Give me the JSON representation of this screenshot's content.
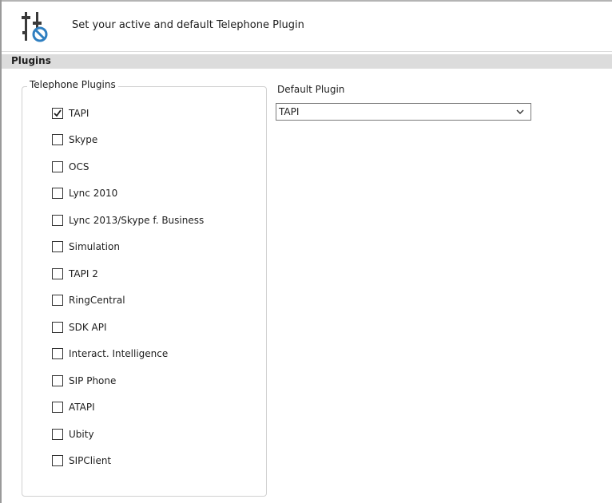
{
  "header": {
    "title": "Set your active and default Telephone Plugin",
    "icon": "telephone-plugin-settings-icon"
  },
  "section": {
    "title": "Plugins"
  },
  "plugins_group": {
    "legend": "Telephone Plugins",
    "items": [
      {
        "label": "TAPI",
        "checked": true
      },
      {
        "label": "Skype",
        "checked": false
      },
      {
        "label": "OCS",
        "checked": false
      },
      {
        "label": "Lync 2010",
        "checked": false
      },
      {
        "label": "Lync 2013/Skype f. Business",
        "checked": false
      },
      {
        "label": "Simulation",
        "checked": false
      },
      {
        "label": "TAPI 2",
        "checked": false
      },
      {
        "label": "RingCentral",
        "checked": false
      },
      {
        "label": "SDK API",
        "checked": false
      },
      {
        "label": "Interact. Intelligence",
        "checked": false
      },
      {
        "label": "SIP Phone",
        "checked": false
      },
      {
        "label": "ATAPI",
        "checked": false
      },
      {
        "label": "Ubity",
        "checked": false
      },
      {
        "label": "SIPClient",
        "checked": false
      }
    ]
  },
  "default_plugin": {
    "label": "Default Plugin",
    "selected": "TAPI"
  },
  "colors": {
    "section_bar": "#dcdcdc",
    "icon_blue": "#2f7fc1",
    "icon_dark": "#3a3a3a"
  }
}
